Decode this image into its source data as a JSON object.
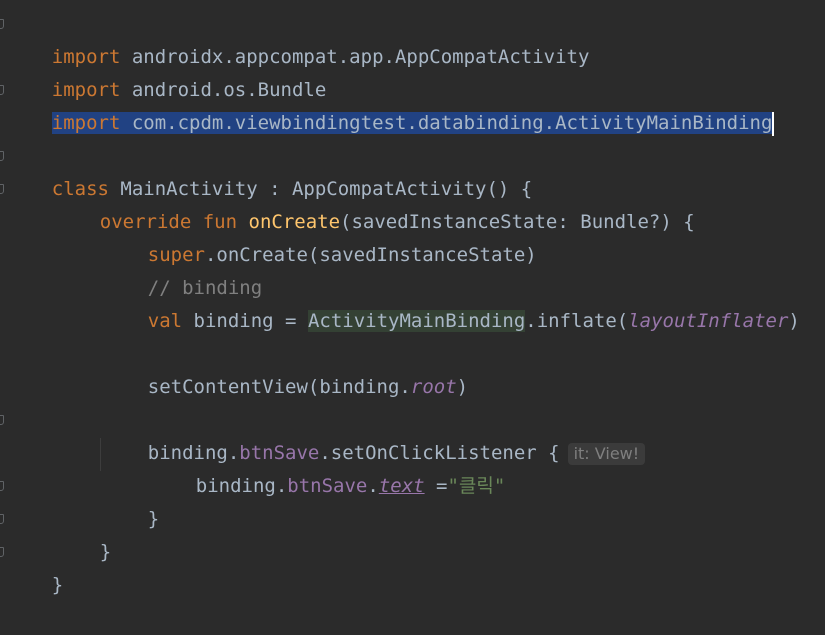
{
  "editor": {
    "lines": {
      "l1": {
        "kw": "import",
        "rest": " androidx.appcompat.app.AppCompatActivity"
      },
      "l2": {
        "kw": "import",
        "rest": " android.os.Bundle"
      },
      "l3": {
        "kw": "import",
        "rest": " com.cpdm.viewbindingtest.databinding.ActivityMainBinding"
      },
      "l5": {
        "kw": "class",
        "rest": " MainActivity : AppCompatActivity() {"
      },
      "l6": {
        "kw1": "override",
        "kw2": "fun",
        "fn": "onCreate",
        "rest": "(savedInstanceState: Bundle?) {"
      },
      "l7": {
        "kw": "super",
        "rest": ".onCreate(savedInstanceState)"
      },
      "l8": {
        "comment": "// binding"
      },
      "l9": {
        "kw": "val",
        "a": " binding = ",
        "type": "ActivityMainBinding",
        "b": ".inflate(",
        "ital": "layoutInflater",
        "c": ")"
      },
      "l11": {
        "a": "setContentView(binding.",
        "ital": "root",
        "b": ")"
      },
      "l13": {
        "a": "binding.",
        "prop": "btnSave",
        "b": ".setOnClickListener {",
        "hint": "it: View!"
      },
      "l14": {
        "a": "binding.",
        "prop": "btnSave",
        "dot": ".",
        "ital": "text",
        "eq": " =",
        "str": "\"클릭\""
      },
      "l15": {
        "a": "}"
      },
      "l16": {
        "a": "}"
      },
      "l17": {
        "a": "}"
      }
    }
  }
}
